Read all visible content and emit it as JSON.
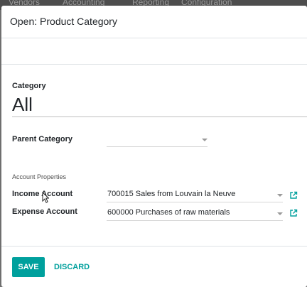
{
  "background_menu": [
    "Vendors",
    "Accounting",
    "Reporting",
    "Configuration"
  ],
  "dialog": {
    "title": "Open: Product Category"
  },
  "form": {
    "name_label": "Category",
    "name_value": "All",
    "parent_label": "Parent Category",
    "parent_value": "",
    "section_title": "Account Properties",
    "income_label": "Income Account",
    "income_value": "700015 Sales from Louvain la Neuve",
    "expense_label": "Expense Account",
    "expense_value": "600000 Purchases of raw materials"
  },
  "footer": {
    "save_label": "SAVE",
    "discard_label": "DISCARD"
  },
  "colors": {
    "primary": "#00a09d",
    "link_icon": "#00a09d"
  },
  "icons": {
    "external_link": "external-link-icon",
    "dropdown": "chevron-down-icon",
    "cursor": "mouse-pointer-icon"
  }
}
